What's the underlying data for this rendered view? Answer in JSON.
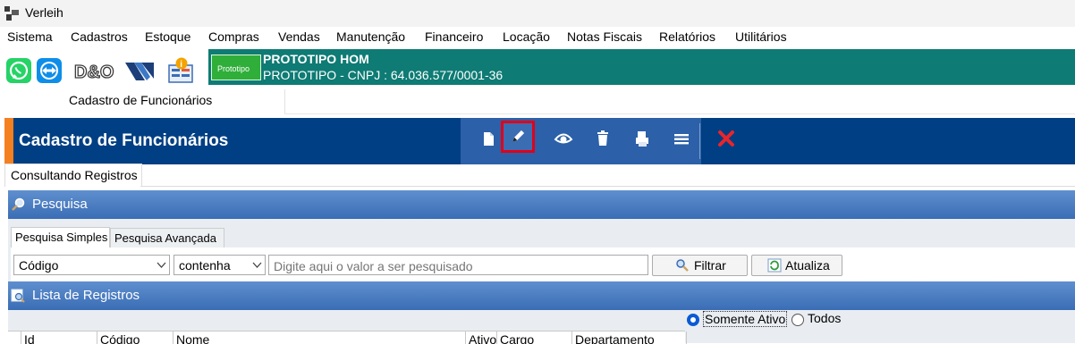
{
  "window": {
    "title": "Verleih"
  },
  "menu": [
    "Sistema",
    "Cadastros",
    "Estoque",
    "Compras",
    "Vendas",
    "Manutenção",
    "Financeiro",
    "Locação",
    "Notas Fiscais",
    "Relatórios",
    "Utilitários"
  ],
  "company": {
    "name": "PROTOTIPO HOM",
    "cnpj_line": "PROTOTIPO - CNPJ : 64.036.577/0001-36",
    "logo_text": "Prototipo"
  },
  "toolstrip": {
    "icons": [
      "whatsapp-icon",
      "teamviewer-icon",
      "dno-logo-icon",
      "brand-logo-icon",
      "info-notes-icon"
    ],
    "dno_text": "D&O"
  },
  "doc_tab": "Cadastro de Funcionários",
  "header": {
    "title": "Cadastro de Funcionários",
    "tools": [
      "new-document-icon",
      "edit-pencil-icon",
      "view-eye-icon",
      "delete-trash-icon",
      "print-icon",
      "menu-icon",
      "close-icon"
    ],
    "selected_tool": "edit-pencil-icon",
    "accent_color": "#f4801f",
    "highlight_color": "#e1001a"
  },
  "sub_tab": "Consultando Registros",
  "search": {
    "title": "Pesquisa",
    "tabs": [
      "Pesquisa Simples",
      "Pesquisa Avançada"
    ],
    "field_select": "Código",
    "operator_select": "contenha",
    "placeholder": "Digite aqui o valor a ser pesquisado",
    "filter_button": "Filtrar",
    "refresh_button": "Atualiza"
  },
  "list": {
    "title": "Lista de Registros",
    "filter_options": [
      "Somente Ativo",
      "Todos"
    ],
    "selected_filter": "Somente Ativo",
    "columns": [
      "Id",
      "Código",
      "Nome",
      "Ativo",
      "Cargo",
      "Departamento"
    ]
  }
}
